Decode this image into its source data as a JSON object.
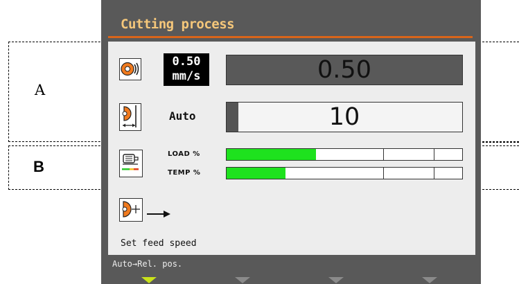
{
  "annotations": {
    "a_label": "A",
    "b_label": "B"
  },
  "panel": {
    "title": "Cutting process",
    "feed": {
      "badge_value": "0.50",
      "badge_unit": "mm/s",
      "display_value": "0.50"
    },
    "mode": {
      "label": "Auto",
      "display_value": "10",
      "level_fraction": 0.05
    },
    "load": {
      "label": "LOAD %",
      "fill_fraction": 0.38
    },
    "temp": {
      "label": "TEMP %",
      "fill_fraction": 0.25
    },
    "status_text": "Set feed speed",
    "softkey_text": "Auto→Rel. pos."
  },
  "colors": {
    "title": "#f5c77a",
    "accent_line": "#d9651a",
    "bar_fill": "#1ee21e",
    "softkey_active": "#c9e21a",
    "icon_orange": "#f07a1e"
  }
}
